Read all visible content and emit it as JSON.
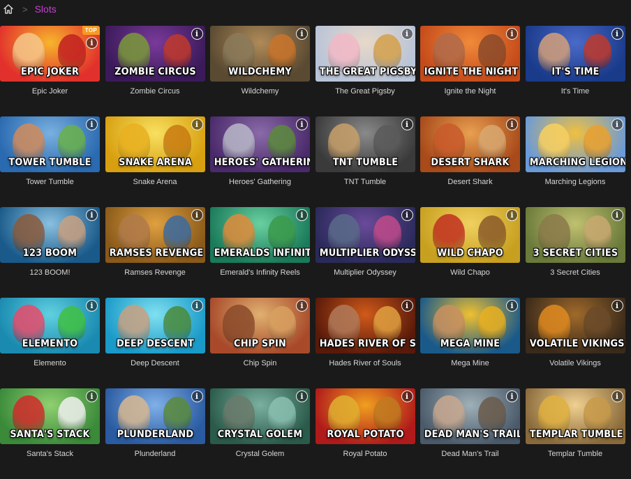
{
  "breadcrumb": {
    "home_icon": "home-icon",
    "separator": ">",
    "current": "Slots"
  },
  "colors": {
    "accent": "#c93fd6",
    "badge": "#f59b23",
    "background": "#1a1a1a"
  },
  "games": [
    {
      "name": "Epic Joker",
      "logo": "EPIC JOKER",
      "badge": "TOP",
      "c1": "#e2312c",
      "c2": "#f7b52c",
      "fig": "#f5c78a",
      "fig2": "#c22020"
    },
    {
      "name": "Zombie Circus",
      "logo": "ZOMBIE CIRCUS",
      "c1": "#3b1a5a",
      "c2": "#7a3a9a",
      "fig": "#7a9a3a",
      "fig2": "#c0392b"
    },
    {
      "name": "Wildchemy",
      "logo": "WILDCHEMY",
      "c1": "#5a4a32",
      "c2": "#b08a58",
      "fig": "#8a7a5a",
      "fig2": "#c9742a"
    },
    {
      "name": "The Great Pigsby",
      "logo": "THE GREAT PIGSBY",
      "c1": "#b8c4d8",
      "c2": "#e8d8c8",
      "fig": "#f2b8c6",
      "fig2": "#d4a04a"
    },
    {
      "name": "Ignite the Night",
      "logo": "IGNITE THE NIGHT",
      "c1": "#c54a1a",
      "c2": "#f08a3a",
      "fig": "#b06a4a",
      "fig2": "#8a4a2a"
    },
    {
      "name": "It's Time",
      "logo": "IT'S TIME",
      "c1": "#1a3a8a",
      "c2": "#4a6ac8",
      "fig": "#d4a07a",
      "fig2": "#c0392b"
    },
    {
      "name": "Tower Tumble",
      "logo": "TOWER TUMBLE",
      "c1": "#2a6ab0",
      "c2": "#7ab0e0",
      "fig": "#d08a5a",
      "fig2": "#6ab04a"
    },
    {
      "name": "Snake Arena",
      "logo": "SNAKE ARENA",
      "c1": "#d8a010",
      "c2": "#f8e060",
      "fig": "#e8b020",
      "fig2": "#c87a10"
    },
    {
      "name": "Heroes' Gathering",
      "logo": "HEROES' GATHERING",
      "c1": "#4a2a6a",
      "c2": "#8a6aa8",
      "fig": "#b8b8c8",
      "fig2": "#5a8a3a"
    },
    {
      "name": "TNT Tumble",
      "logo": "TNT TUMBLE",
      "c1": "#3a3a3a",
      "c2": "#8a8a8a",
      "fig": "#c8a06a",
      "fig2": "#5a5a5a"
    },
    {
      "name": "Desert Shark",
      "logo": "DESERT SHARK",
      "c1": "#a84a1a",
      "c2": "#e8a050",
      "fig": "#c85a2a",
      "fig2": "#d8a870"
    },
    {
      "name": "Marching Legions",
      "logo": "MARCHING LEGIONS",
      "c1": "#6a9ad8",
      "c2": "#f0c040",
      "fig": "#f8d060",
      "fig2": "#e8a030"
    },
    {
      "name": "123 BOOM!",
      "logo": "123 BOOM",
      "c1": "#1a5a8a",
      "c2": "#8ac0e0",
      "fig": "#8a5a3a",
      "fig2": "#c8a080"
    },
    {
      "name": "Ramses Revenge",
      "logo": "RAMSES REVENGE",
      "c1": "#8a5a1a",
      "c2": "#e0a040",
      "fig": "#b07a4a",
      "fig2": "#3a6aa0"
    },
    {
      "name": "Emerald's Infinity Reels",
      "logo": "EMERALDS INFINITY REELS",
      "c1": "#1a7a5a",
      "c2": "#6ad0a0",
      "fig": "#e08a3a",
      "fig2": "#3a9a4a"
    },
    {
      "name": "Multiplier Odyssey",
      "logo": "MULTIPLIER ODYSSEY",
      "c1": "#2a2a5a",
      "c2": "#6a4a9a",
      "fig": "#5a6a8a",
      "fig2": "#c04a8a"
    },
    {
      "name": "Wild Chapo",
      "logo": "WILD CHAPO",
      "c1": "#c8a020",
      "c2": "#f0d060",
      "fig": "#c03020",
      "fig2": "#8a5a2a"
    },
    {
      "name": "3 Secret Cities",
      "logo": "3 SECRET CITIES",
      "c1": "#6a7a3a",
      "c2": "#c0c070",
      "fig": "#8a7a4a",
      "fig2": "#c8a870"
    },
    {
      "name": "Elemento",
      "logo": "ELEMENTO",
      "c1": "#1a8ab0",
      "c2": "#60d0e0",
      "fig": "#e84a6a",
      "fig2": "#40c040"
    },
    {
      "name": "Deep Descent",
      "logo": "DEEP DESCENT",
      "c1": "#1a9ac8",
      "c2": "#80e0f0",
      "fig": "#c8a080",
      "fig2": "#4a8a3a"
    },
    {
      "name": "Chip Spin",
      "logo": "CHIP SPIN",
      "c1": "#a84a2a",
      "c2": "#e0b070",
      "fig": "#8a4a2a",
      "fig2": "#d8a060"
    },
    {
      "name": "Hades River of Souls",
      "logo": "HADES RIVER OF SOULS",
      "c1": "#5a1a0a",
      "c2": "#d05a1a",
      "fig": "#b07a5a",
      "fig2": "#e0a040"
    },
    {
      "name": "Mega Mine",
      "logo": "MEGA MINE",
      "c1": "#1a5a8a",
      "c2": "#f0c030",
      "fig": "#c89060",
      "fig2": "#e8b020"
    },
    {
      "name": "Volatile Vikings",
      "logo": "VOLATILE VIKINGS",
      "c1": "#3a2a1a",
      "c2": "#a06a2a",
      "fig": "#e08a20",
      "fig2": "#6a4a2a"
    },
    {
      "name": "Santa's Stack",
      "logo": "SANTA'S STACK",
      "c1": "#3a8a3a",
      "c2": "#90d070",
      "fig": "#d02a2a",
      "fig2": "#f0f0f0"
    },
    {
      "name": "Plunderland",
      "logo": "PLUNDERLAND",
      "c1": "#2a5aa0",
      "c2": "#80b0e8",
      "fig": "#d8b890",
      "fig2": "#5a8a3a"
    },
    {
      "name": "Crystal Golem",
      "logo": "CRYSTAL GOLEM",
      "c1": "#2a5a4a",
      "c2": "#7ab0a0",
      "fig": "#6a7a6a",
      "fig2": "#8ac0b0"
    },
    {
      "name": "Royal Potato",
      "logo": "ROYAL POTATO",
      "c1": "#b01a1a",
      "c2": "#f0a020",
      "fig": "#e0b030",
      "fig2": "#c07a20"
    },
    {
      "name": "Dead Man's Trail",
      "logo": "DEAD MAN'S TRAIL",
      "c1": "#4a5a6a",
      "c2": "#a0b0b8",
      "fig": "#c8a890",
      "fig2": "#6a5a4a"
    },
    {
      "name": "Templar Tumble",
      "logo": "TEMPLAR TUMBLE",
      "c1": "#8a6a3a",
      "c2": "#f0d090",
      "fig": "#e0b040",
      "fig2": "#c89a4a"
    }
  ]
}
